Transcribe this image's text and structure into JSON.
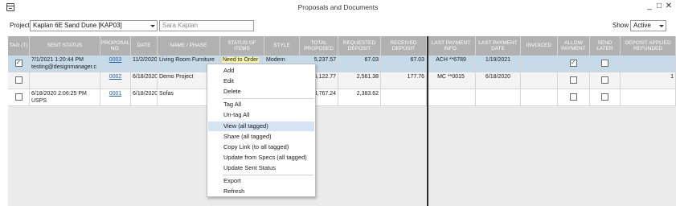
{
  "window": {
    "title": "Proposals and Documents",
    "minimize": "_",
    "maximize": "□",
    "close": "✕"
  },
  "toolbar": {
    "project_label": "Project",
    "project_value": "Kaplan 6E Sand Dune  [KAP03]",
    "client_value": "Sara Kaplan",
    "show_label": "Show",
    "show_value": "Active"
  },
  "columns": [
    "TAG (T)",
    "SENT STATUS",
    "PROPOSAL NO.",
    "DATE",
    "NAME / PHASE",
    "STATUS OF ITEMS",
    "STYLE",
    "TOTAL PROPOSED",
    "REQUESTED DEPOSIT",
    "RECEIVED DEPOSIT",
    "LAST PAYMENT INFO.",
    "LAST PAYMENT DATE",
    "INVOICED",
    "ALLOW PAYMENT",
    "SEND LATER",
    "DEPOSIT APPLIED REFUNDED"
  ],
  "rows": [
    {
      "tag": true,
      "sent_status_1": "7/1/2021 1:20:44 PM",
      "sent_status_2": "testing@designmanager.c",
      "proposal_no": "0003",
      "date": "11/2/2020",
      "name": "Living Room Furniture",
      "status_of_items": "Need to Order",
      "style": "Modern",
      "total_proposed": "5,237.57",
      "requested_deposit": "67.03",
      "received_deposit": "67.03",
      "last_payment_info": "ACH **6789",
      "last_payment_date": "1/19/2021",
      "invoiced": "",
      "allow_payment": true,
      "send_later": false,
      "deposit_applied": ""
    },
    {
      "tag": false,
      "sent_status_1": "",
      "sent_status_2": "",
      "proposal_no": "0002",
      "date": "6/18/2020",
      "name": "Demo Project",
      "status_of_items": "",
      "style": "",
      "total_proposed": "5,122.77",
      "requested_deposit": "2,561.38",
      "received_deposit": "177.76",
      "last_payment_info": "MC **0015",
      "last_payment_date": "6/18/2020",
      "invoiced": "",
      "allow_payment": false,
      "send_later": false,
      "deposit_applied": "1"
    },
    {
      "tag": false,
      "sent_status_1": "6/18/2020 2:06:25 PM",
      "sent_status_2": "USPS",
      "proposal_no": "0001",
      "date": "6/18/2020",
      "name": "Sofas",
      "status_of_items": "",
      "style": "",
      "total_proposed": "4,767.24",
      "requested_deposit": "2,383.62",
      "received_deposit": "",
      "last_payment_info": "",
      "last_payment_date": "",
      "invoiced": "",
      "allow_payment": false,
      "send_later": false,
      "deposit_applied": ""
    }
  ],
  "context_menu": {
    "items": [
      "Add",
      "Edit",
      "Delete",
      "Tag All",
      "Un-tag All",
      "View (all tagged)",
      "Share (all tagged)",
      "Copy Link (to all tagged)",
      "Update from Specs (all tagged)",
      "Update Sent Status",
      "Export",
      "Refresh"
    ],
    "highlighted": "View (all tagged)"
  },
  "colors": {
    "header_bg": "#b1b1b1",
    "selected_row": "#c6dae8",
    "link": "#1f5fa8",
    "status_highlight": "#fff7a6",
    "menu_hover": "#d6e3f2"
  }
}
